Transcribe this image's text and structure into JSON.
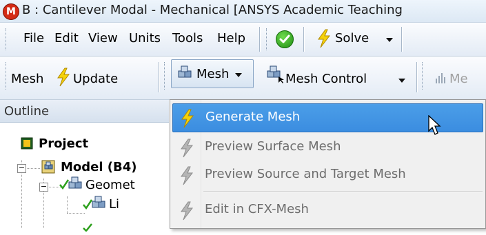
{
  "window": {
    "title": "B : Cantilever Modal - Mechanical [ANSYS Academic Teaching",
    "app_icon_letter": "M"
  },
  "menubar": {
    "items": [
      "File",
      "Edit",
      "View",
      "Units",
      "Tools",
      "Help"
    ],
    "solve_label": "Solve"
  },
  "mesh_toolbar": {
    "mesh_label": "Mesh",
    "update_label": "Update",
    "mesh_dropdown_label": "Mesh",
    "mesh_control_label": "Mesh Control",
    "metrics_partial": "Me"
  },
  "outline": {
    "header": "Outline",
    "tree": {
      "project": "Project",
      "model": "Model (B4)",
      "geometry": "Geomet",
      "line_body": "Li"
    }
  },
  "mesh_menu": {
    "items": [
      {
        "label": "Generate Mesh",
        "enabled": true,
        "highlighted": true
      },
      {
        "label": "Preview Surface Mesh",
        "enabled": false
      },
      {
        "label": "Preview Source and Target Mesh",
        "enabled": false
      },
      {
        "label": "Edit in CFX-Mesh",
        "enabled": false
      }
    ]
  },
  "colors": {
    "highlight": "#3b8de0",
    "bolt_yellow": "#f5d20a",
    "check_green": "#2da01c",
    "app_icon_red": "#d42b16"
  }
}
